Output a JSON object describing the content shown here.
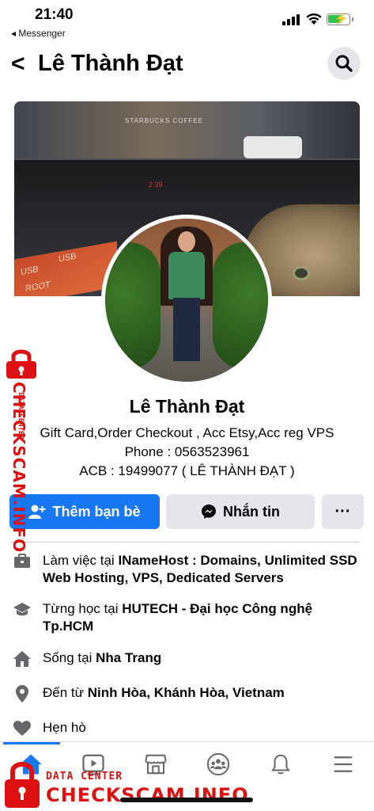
{
  "status_bar": {
    "time": "21:40",
    "back_app": "◂ Messenger"
  },
  "header": {
    "back_glyph": "<",
    "title": "Lê Thành Đạt"
  },
  "cover": {
    "storefront_sign": "STARBUCKS COFFEE",
    "dash_display": "2 39",
    "usb_label_1": "USB",
    "usb_label_2": "USB",
    "usb_label_3": "ROOT"
  },
  "profile": {
    "name": "Lê Thành Đạt",
    "bio_lines": [
      "Gift Card,Order Checkout , Acc Etsy,Acc reg VPS",
      "Phone : 0563523961",
      "ACB : 19499077 ( LÊ THÀNH ĐẠT )"
    ]
  },
  "actions": {
    "add_friend": "Thêm bạn bè",
    "message": "Nhắn tin",
    "more": "···"
  },
  "info": [
    {
      "icon": "briefcase-icon",
      "prefix": "Làm việc tại ",
      "value": "INameHost : Domains, Unlimited SSD Web Hosting, VPS, Dedicated Servers"
    },
    {
      "icon": "graduation-cap-icon",
      "prefix": "Từng học tại ",
      "value": "HUTECH - Đại học Công nghệ Tp.HCM"
    },
    {
      "icon": "home-icon",
      "prefix": "Sống tại ",
      "value": "Nha Trang"
    },
    {
      "icon": "location-pin-icon",
      "prefix": "Đến từ ",
      "value": "Ninh Hòa, Khánh Hòa, Vietnam"
    },
    {
      "icon": "heart-icon",
      "prefix": "Hẹn hò",
      "value": ""
    }
  ],
  "tabbar": {
    "tabs": [
      "home-icon",
      "video-icon",
      "marketplace-icon",
      "groups-icon",
      "bell-icon",
      "menu-icon"
    ],
    "active": "home-icon",
    "accent": "#1877f2"
  },
  "watermark": {
    "side_small": "DATA CENTER",
    "side_big": "CHECKSCAM.INFO",
    "bottom_small": "DATA CENTER",
    "bottom_big": "CHECKSCAM.INFO",
    "color": "#dd1111"
  }
}
